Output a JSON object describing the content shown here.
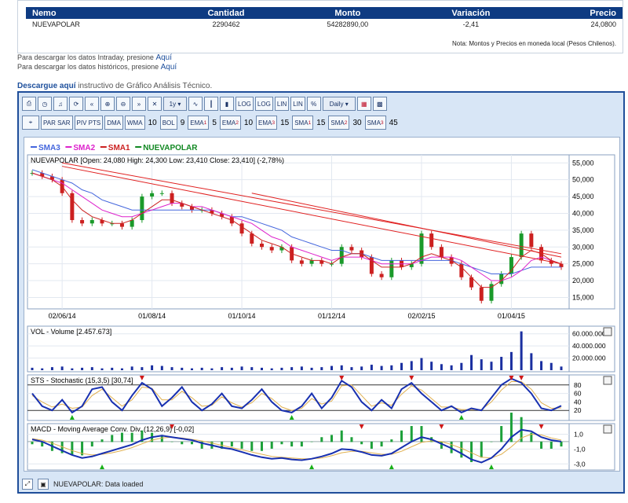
{
  "quote_table": {
    "headers": [
      "Nemo",
      "Cantidad",
      "Monto",
      "Variación",
      "Precio"
    ],
    "row": [
      "NUEVAPOLAR",
      "2290462",
      "54282890,00",
      "-2,41",
      "24,0800"
    ],
    "note": "Nota: Montos y Precios en moneda local (Pesos Chilenos)."
  },
  "download_links": [
    {
      "text": "Para descargar los datos Intraday, presione",
      "link": "Aquí"
    },
    {
      "text": "Para descargar los datos históricos, presione",
      "link": "Aquí"
    }
  ],
  "instructivo": {
    "link": "Descargue aquí",
    "text": "instructivo de Gráfico Análisis Técnico."
  },
  "toolbar1": {
    "period": "1y",
    "log1": "LOG",
    "log2": "LOG",
    "lin1": "LIN",
    "lin2": "LIN",
    "pct": "%",
    "interval": "Daily"
  },
  "toolbar2": {
    "parsar": "PAR SAR",
    "pivpts": "PIV PTS",
    "dma": "DMA",
    "wma": "WMA",
    "wma_val": "10",
    "bol": "BOL",
    "bol_val": "9",
    "ema1": "EMA",
    "ema1_val": "5",
    "ema2": "EMA",
    "ema2_val": "10",
    "ema3": "EMA",
    "ema3_val": "15",
    "sma1": "SMA",
    "sma1_val": "15",
    "sma2": "SMA",
    "sma2_val": "30",
    "sma3": "SMA",
    "sma3_val": "45"
  },
  "chart_data": {
    "type": "line",
    "legend": [
      {
        "name": "SMA3",
        "color": "#4466dd"
      },
      {
        "name": "SMA2",
        "color": "#dd22cc"
      },
      {
        "name": "SMA1",
        "color": "#cc2222"
      },
      {
        "name": "NUEVAPOLAR",
        "color": "#118822"
      }
    ],
    "price_title": "NUEVAPOLAR [Open: 24,080  High: 24,300  Low: 23,410  Close: 23,410] (-2,78%)",
    "x_ticks": [
      "02/06/14",
      "01/08/14",
      "01/10/14",
      "01/12/14",
      "02/02/15",
      "01/04/15"
    ],
    "price_y_ticks": [
      "55,000",
      "50,000",
      "45,000",
      "40,000",
      "35,000",
      "30,000",
      "25,000",
      "20,000",
      "15,000"
    ],
    "price_ylim": [
      13,
      56
    ],
    "close": [
      52,
      51,
      50,
      46,
      38,
      37,
      38,
      37,
      37,
      36,
      38,
      45,
      46,
      46,
      43,
      42,
      41,
      41,
      40,
      39,
      37,
      34,
      31,
      30,
      29,
      30,
      26,
      25,
      26,
      25,
      25,
      30,
      29,
      27,
      22,
      21,
      26,
      24,
      25,
      34,
      30,
      27,
      25,
      21,
      18,
      14,
      19,
      22,
      27,
      34,
      30,
      26,
      25,
      24
    ],
    "sma1": [
      52,
      51,
      50,
      48,
      44,
      41,
      39,
      38,
      37,
      37,
      38,
      40,
      42,
      44,
      44,
      43,
      42,
      41,
      40,
      39,
      38,
      36,
      34,
      32,
      31,
      30,
      28,
      27,
      26,
      26,
      25,
      27,
      28,
      28,
      26,
      24,
      24,
      24,
      25,
      27,
      28,
      27,
      26,
      24,
      21,
      18,
      18,
      20,
      23,
      27,
      29,
      28,
      26,
      25
    ],
    "sma2": [
      52,
      51,
      50,
      49,
      47,
      45,
      43,
      41,
      40,
      39,
      39,
      40,
      41,
      42,
      43,
      43,
      42,
      42,
      41,
      40,
      39,
      38,
      37,
      35,
      33,
      32,
      30,
      29,
      28,
      27,
      26,
      27,
      27,
      27,
      26,
      25,
      25,
      25,
      25,
      26,
      27,
      27,
      27,
      26,
      24,
      22,
      20,
      20,
      21,
      23,
      26,
      27,
      26,
      25
    ],
    "sma3": [
      53,
      52,
      51,
      50,
      49,
      47,
      46,
      44,
      43,
      42,
      41,
      41,
      41,
      41,
      41,
      41,
      41,
      41,
      41,
      40,
      39,
      39,
      38,
      37,
      36,
      35,
      33,
      32,
      31,
      30,
      29,
      29,
      28,
      28,
      27,
      26,
      26,
      26,
      26,
      26,
      26,
      26,
      26,
      25,
      24,
      23,
      22,
      22,
      22,
      23,
      24,
      24,
      24,
      24
    ],
    "trendlines": [
      {
        "from": [
          3,
          55
        ],
        "to": [
          53,
          28
        ]
      },
      {
        "from": [
          3,
          54
        ],
        "to": [
          53,
          25
        ]
      },
      {
        "from": [
          22,
          46
        ],
        "to": [
          53,
          27
        ]
      }
    ],
    "volume_title": "VOL - Volume [2.457.673]",
    "volume_y_ticks": [
      "60.000.000",
      "40.000.000",
      "20.000.000"
    ],
    "volume_ylim": [
      0,
      70
    ],
    "volume": [
      4,
      3,
      5,
      6,
      3,
      4,
      5,
      3,
      4,
      3,
      6,
      5,
      8,
      7,
      5,
      4,
      3,
      4,
      3,
      5,
      4,
      6,
      5,
      4,
      3,
      4,
      5,
      6,
      4,
      5,
      7,
      8,
      5,
      6,
      9,
      7,
      8,
      12,
      15,
      20,
      14,
      10,
      8,
      12,
      25,
      18,
      14,
      22,
      30,
      64,
      28,
      15,
      12,
      6
    ],
    "stoch_title": "STS - Stochastic (15,3,5) [30,74]",
    "stoch_y_ticks": [
      "80",
      "60",
      "40",
      "20"
    ],
    "stoch_ylim": [
      0,
      100
    ],
    "stoch_k": [
      60,
      30,
      20,
      45,
      15,
      30,
      70,
      75,
      40,
      20,
      55,
      85,
      70,
      30,
      50,
      75,
      40,
      20,
      35,
      60,
      30,
      25,
      45,
      70,
      40,
      20,
      15,
      30,
      60,
      25,
      50,
      90,
      75,
      40,
      20,
      45,
      25,
      70,
      85,
      60,
      40,
      20,
      30,
      15,
      25,
      20,
      50,
      80,
      95,
      85,
      60,
      25,
      20,
      31
    ],
    "stoch_d": [
      55,
      40,
      28,
      35,
      25,
      28,
      55,
      70,
      50,
      30,
      45,
      75,
      72,
      45,
      45,
      65,
      50,
      30,
      32,
      52,
      38,
      28,
      38,
      60,
      48,
      28,
      20,
      25,
      48,
      35,
      42,
      78,
      80,
      55,
      30,
      38,
      32,
      58,
      78,
      68,
      48,
      28,
      28,
      22,
      22,
      22,
      40,
      68,
      88,
      88,
      70,
      38,
      25,
      26
    ],
    "macd_title": "MACD - Moving Average Conv. Div. (12,26,9) [-0,02]",
    "macd_y_ticks": [
      "1,0",
      "-1,0",
      "-3,0"
    ],
    "macd_ylim": [
      -3.5,
      2.0
    ],
    "macd": [
      0.3,
      0.0,
      -0.6,
      -1.2,
      -1.8,
      -2.2,
      -2.0,
      -1.6,
      -1.2,
      -0.8,
      -0.4,
      0.2,
      0.6,
      0.8,
      0.6,
      0.4,
      0.2,
      -0.2,
      -0.5,
      -0.8,
      -1.0,
      -1.4,
      -1.8,
      -2.1,
      -2.3,
      -2.2,
      -2.4,
      -2.5,
      -2.3,
      -2.0,
      -1.6,
      -1.0,
      -1.1,
      -1.4,
      -1.8,
      -1.9,
      -1.6,
      -0.8,
      0.0,
      0.6,
      0.3,
      -0.3,
      -0.9,
      -1.6,
      -2.4,
      -2.8,
      -2.2,
      -1.0,
      0.6,
      1.6,
      1.4,
      0.6,
      0.2,
      0.0
    ],
    "macd_signal": [
      0.4,
      0.2,
      -0.2,
      -0.7,
      -1.2,
      -1.6,
      -1.8,
      -1.7,
      -1.5,
      -1.2,
      -0.8,
      -0.3,
      0.2,
      0.5,
      0.6,
      0.5,
      0.3,
      0.1,
      -0.2,
      -0.5,
      -0.8,
      -1.1,
      -1.4,
      -1.7,
      -2.0,
      -2.1,
      -2.2,
      -2.3,
      -2.3,
      -2.2,
      -1.9,
      -1.5,
      -1.3,
      -1.3,
      -1.5,
      -1.7,
      -1.7,
      -1.3,
      -0.7,
      -0.1,
      0.1,
      0.0,
      -0.4,
      -0.9,
      -1.5,
      -2.1,
      -2.2,
      -1.7,
      -0.7,
      0.5,
      1.0,
      0.9,
      0.5,
      0.2
    ],
    "legend_position": "top-left",
    "grid": true
  },
  "status": {
    "text": "NUEVAPOLAR: Data loaded"
  }
}
